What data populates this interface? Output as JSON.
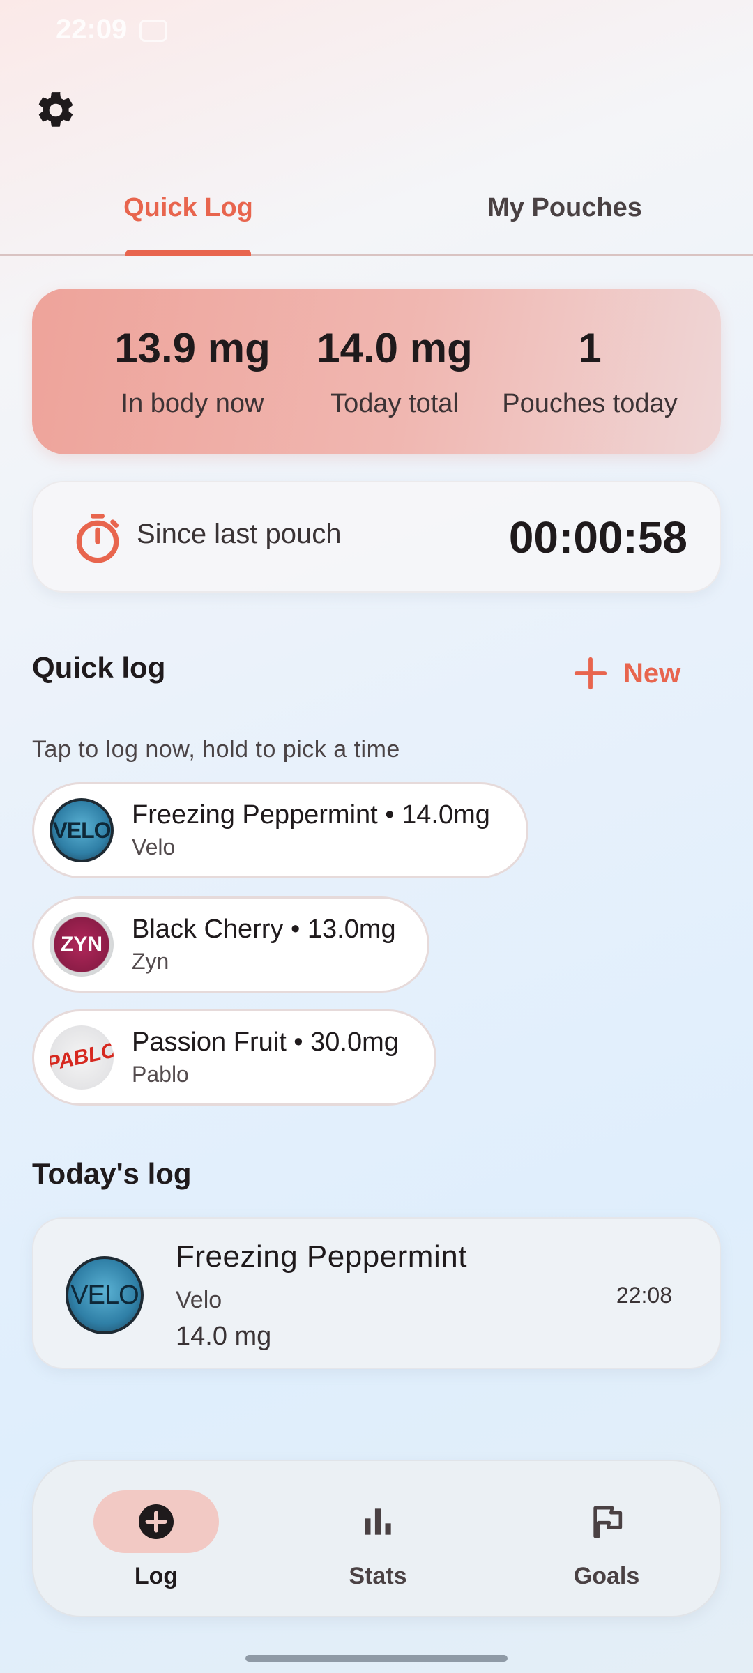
{
  "status_bar": {
    "time": "22:09"
  },
  "tabs": [
    {
      "label": "Quick Log",
      "active": true
    },
    {
      "label": "My Pouches",
      "active": false
    }
  ],
  "summary": {
    "in_body_value": "13.9 mg",
    "in_body_label": "In body now",
    "today_value": "14.0 mg",
    "today_label": "Today total",
    "pouches_value": "1",
    "pouches_label": "Pouches today"
  },
  "timer": {
    "label": "Since last pouch",
    "value": "00:00:58"
  },
  "quick_log": {
    "title": "Quick log",
    "new_label": "New",
    "hint": "Tap to log now, hold to pick a time",
    "items": [
      {
        "title": "Freezing Peppermint • 14.0mg",
        "brand": "Velo",
        "icon": "velo-can-icon"
      },
      {
        "title": "Black Cherry • 13.0mg",
        "brand": "Zyn",
        "icon": "zyn-can-icon"
      },
      {
        "title": "Passion Fruit • 30.0mg",
        "brand": "Pablo",
        "icon": "pablo-can-icon"
      }
    ]
  },
  "todays_log": {
    "title": "Today's log",
    "entries": [
      {
        "name": "Freezing Peppermint",
        "brand": "Velo",
        "amount": "14.0 mg",
        "time": "22:08"
      }
    ]
  },
  "nav": [
    {
      "label": "Log",
      "icon": "add-circle-icon",
      "active": true
    },
    {
      "label": "Stats",
      "icon": "bar-chart-icon",
      "active": false
    },
    {
      "label": "Goals",
      "icon": "flag-icon",
      "active": false
    }
  ],
  "colors": {
    "accent": "#e8654e",
    "summary_bg": "#eea39a",
    "active_pill": "#f2c9c4"
  }
}
